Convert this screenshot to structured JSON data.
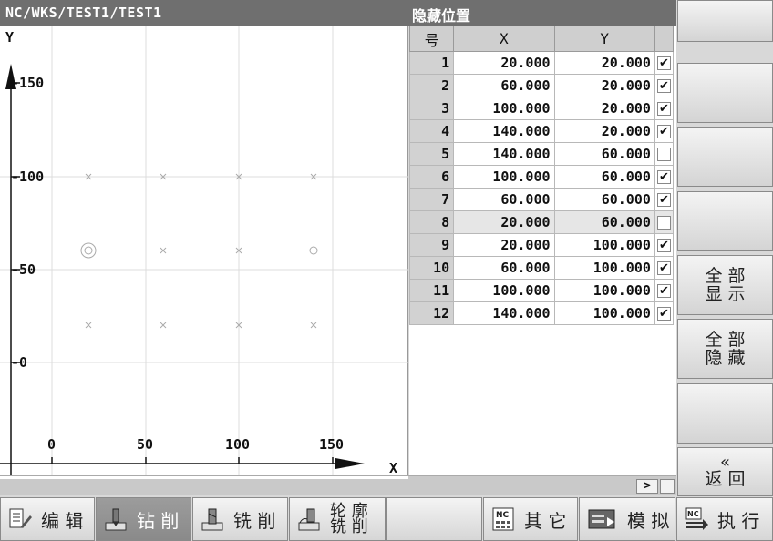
{
  "titlebar": {
    "path": "NC/WKS/TEST1/TEST1",
    "title": "隐藏位置"
  },
  "plot": {
    "x_axis_label": "X",
    "y_axis_label": "Y",
    "x_ticks": [
      "0",
      "50",
      "100",
      "150"
    ],
    "y_ticks": [
      "-150",
      "-100",
      "-50",
      "-0"
    ]
  },
  "table": {
    "headers": {
      "no": "号",
      "x": "X",
      "y": "Y"
    },
    "rows": [
      {
        "no": "1",
        "x": "20.000",
        "y": "20.000",
        "checked": true
      },
      {
        "no": "2",
        "x": "60.000",
        "y": "20.000",
        "checked": true
      },
      {
        "no": "3",
        "x": "100.000",
        "y": "20.000",
        "checked": true
      },
      {
        "no": "4",
        "x": "140.000",
        "y": "20.000",
        "checked": true
      },
      {
        "no": "5",
        "x": "140.000",
        "y": "60.000",
        "checked": false
      },
      {
        "no": "6",
        "x": "100.000",
        "y": "60.000",
        "checked": true
      },
      {
        "no": "7",
        "x": "60.000",
        "y": "60.000",
        "checked": true
      },
      {
        "no": "8",
        "x": "20.000",
        "y": "60.000",
        "checked": false
      },
      {
        "no": "9",
        "x": "20.000",
        "y": "100.000",
        "checked": true
      },
      {
        "no": "10",
        "x": "60.000",
        "y": "100.000",
        "checked": true
      },
      {
        "no": "11",
        "x": "100.000",
        "y": "100.000",
        "checked": true
      },
      {
        "no": "12",
        "x": "140.000",
        "y": "100.000",
        "checked": true
      }
    ]
  },
  "scroll": {
    "right_label": ">"
  },
  "softkeys_right": {
    "show_all": [
      "全 部",
      "显 示"
    ],
    "hide_all": [
      "全 部",
      "隐 藏"
    ],
    "back_arrow": "«",
    "back": "返 回"
  },
  "softkeys_bottom": {
    "edit": "编 辑",
    "drill": "钻 削",
    "mill": "铣 削",
    "contour_mill": [
      "轮 廓",
      "铣 削"
    ],
    "other": "其 它",
    "simulate": "模 拟",
    "execute": "执 行",
    "nc_badge": "NC"
  }
}
